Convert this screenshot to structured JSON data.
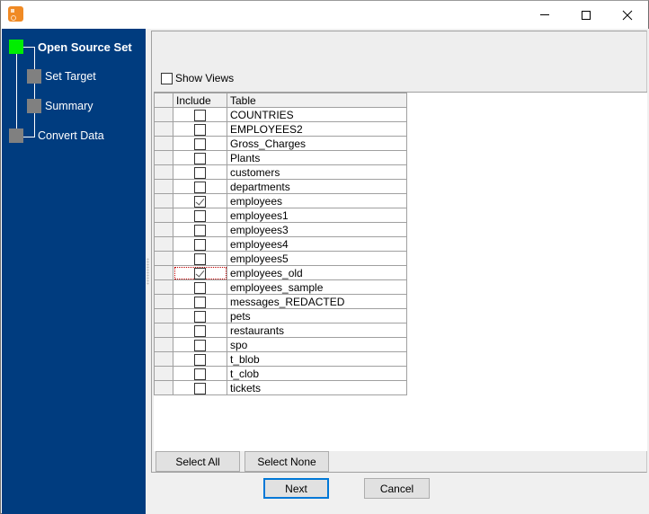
{
  "window": {
    "title": "",
    "controls": {
      "minimize": "minimize",
      "maximize": "maximize",
      "close": "close"
    }
  },
  "wizard": {
    "steps": [
      {
        "label": "Open Source Set",
        "state": "active"
      },
      {
        "label": "Set Target",
        "state": "pending"
      },
      {
        "label": "Summary",
        "state": "pending"
      },
      {
        "label": "Convert Data",
        "state": "pending"
      }
    ],
    "colors": {
      "sidebar": "#003c7f",
      "active_step": "#00ee00",
      "pending_step": "#808080"
    }
  },
  "options": {
    "show_views_label": "Show Views",
    "show_views_checked": false
  },
  "grid": {
    "columns": [
      "",
      "Include",
      "Table"
    ],
    "rows": [
      {
        "table": "COUNTRIES",
        "include": false
      },
      {
        "table": "EMPLOYEES2",
        "include": false
      },
      {
        "table": "Gross_Charges",
        "include": false
      },
      {
        "table": "Plants",
        "include": false
      },
      {
        "table": "customers",
        "include": false
      },
      {
        "table": "departments",
        "include": false
      },
      {
        "table": "employees",
        "include": true
      },
      {
        "table": "employees1",
        "include": false
      },
      {
        "table": "employees3",
        "include": false
      },
      {
        "table": "employees4",
        "include": false
      },
      {
        "table": "employees5",
        "include": false
      },
      {
        "table": "employees_old",
        "include": true,
        "focused": true
      },
      {
        "table": "employees_sample",
        "include": false
      },
      {
        "table": "messages_REDACTED",
        "include": false
      },
      {
        "table": "pets",
        "include": false
      },
      {
        "table": "restaurants",
        "include": false
      },
      {
        "table": "spo",
        "include": false
      },
      {
        "table": "t_blob",
        "include": false
      },
      {
        "table": "t_clob",
        "include": false
      },
      {
        "table": "tickets",
        "include": false
      }
    ]
  },
  "buttons": {
    "select_all": "Select All",
    "select_none": "Select None",
    "next": "Next",
    "cancel": "Cancel"
  }
}
